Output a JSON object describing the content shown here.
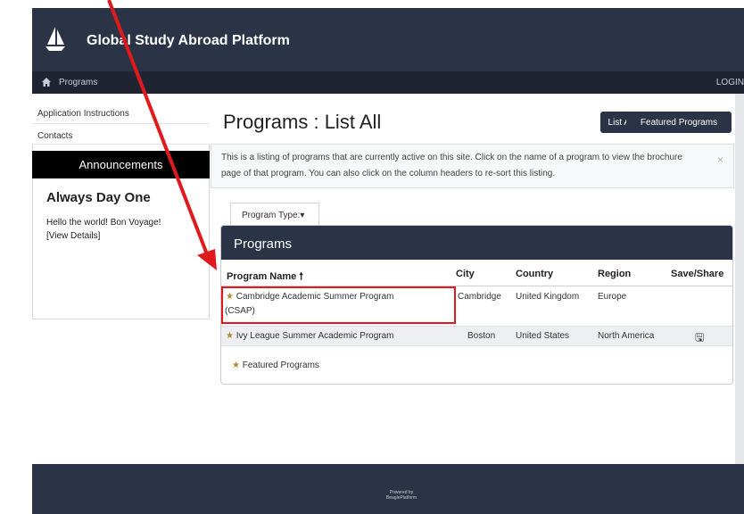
{
  "header": {
    "brand": "Global Study Abroad Platform"
  },
  "navbar": {
    "programs_label": "Programs",
    "login_label": "LOGIN"
  },
  "sidebar": {
    "links": [
      "Application Instructions",
      "Contacts"
    ],
    "announcements_label": "Announcements",
    "announcement": {
      "title": "Always Day One",
      "text": "Hello the world! Bon Voyage!",
      "link": "[View Details]"
    }
  },
  "main": {
    "title": "Programs : List All",
    "buttons": {
      "list_all": "List All",
      "featured": "Featured Programs"
    },
    "info_text": "This is a listing of programs that are currently active on this site. Click on the name of a program to view the brochure page of that program. You can also click on the column headers to re-sort this listing.",
    "info_close": "×",
    "program_type_label": "Program Type:▾"
  },
  "table": {
    "panel_title": "Programs",
    "headers": {
      "name": "Program Name 🠕",
      "city": "City",
      "country": "Country",
      "region": "Region",
      "save": "Save/Share"
    },
    "rows": [
      {
        "name_line1": "Cambridge Academic Summer Program",
        "name_line2": "(CSAP)",
        "city": "Cambridge",
        "country": "United Kingdom",
        "region": "Europe",
        "save": ""
      },
      {
        "name": "Ivy League Summer Academic Program",
        "city": "Boston",
        "country": "United States",
        "region": "North America",
        "save": "🖫"
      }
    ],
    "legend": "Featured Programs",
    "star": "★"
  },
  "footer": {
    "line1": "Powered by",
    "line2": "BeaglePlatform"
  },
  "colors": {
    "header": "#2b3346",
    "highlight": "#e0191d",
    "star": "#b08a2e"
  }
}
